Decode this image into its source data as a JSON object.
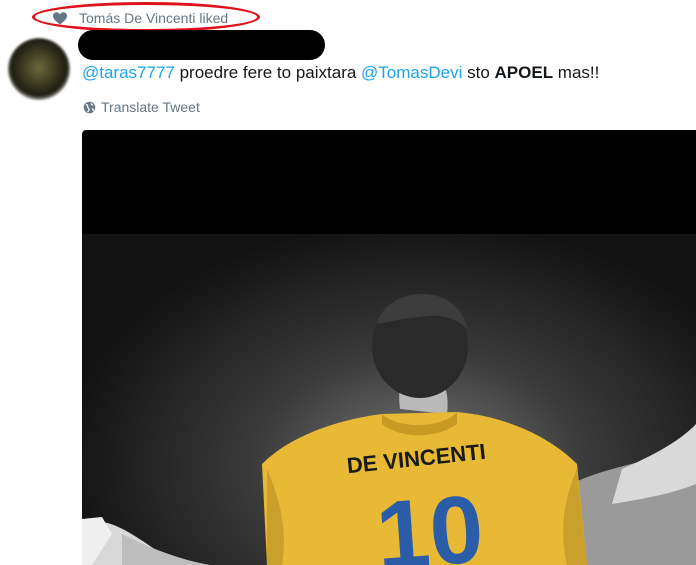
{
  "liked_banner": {
    "text": "Tomás De Vincenti liked",
    "icon": "heart-icon"
  },
  "tweet": {
    "mention1": "@taras7777",
    "text_part1": " proedre fere to paixtara ",
    "mention2": "@TomasDevi",
    "text_part2": " sto ",
    "bold_word": "APOEL",
    "text_part3": " mas!!"
  },
  "translate": {
    "label": "Translate Tweet",
    "icon": "globe-icon"
  },
  "media": {
    "jersey_text": "DE VINCENTI",
    "jersey_number": "10"
  },
  "colors": {
    "mention": "#1da1f2",
    "meta": "#657786",
    "highlight": "#e0101a",
    "jersey": "#e7b934",
    "number": "#2b5ca8"
  }
}
